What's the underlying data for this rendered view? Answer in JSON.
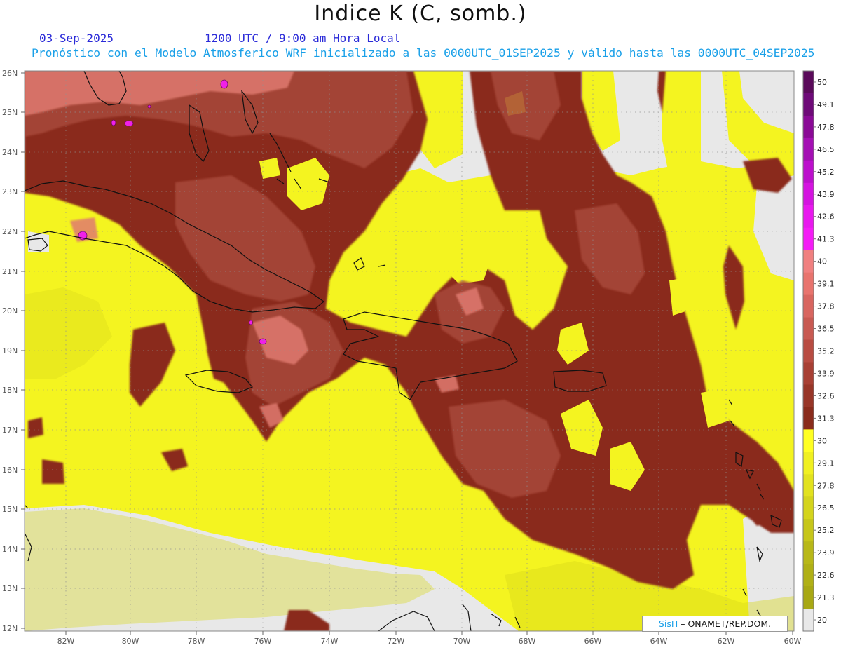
{
  "header": {
    "title": "Indice K (C, somb.)",
    "date": "03-Sep-2025",
    "time": "1200 UTC / 9:00 am Hora Local",
    "forecast": "Pronóstico con el Modelo Atmosferico WRF inicializado a las 0000UTC_01SEP2025 y válido hasta las  0000UTC_04SEP2025"
  },
  "axes": {
    "lat_labels": [
      "26N",
      "25N",
      "24N",
      "23N",
      "22N",
      "21N",
      "20N",
      "19N",
      "18N",
      "17N",
      "16N",
      "15N",
      "14N",
      "13N",
      "12N"
    ],
    "lon_labels": [
      "82W",
      "80W",
      "78W",
      "76W",
      "74W",
      "72W",
      "70W",
      "68W",
      "66W",
      "64W",
      "62W",
      "60W"
    ]
  },
  "colorbar": {
    "labels": [
      "50",
      "49.1",
      "47.8",
      "46.5",
      "45.2",
      "43.9",
      "42.6",
      "41.3",
      "40",
      "39.1",
      "37.8",
      "36.5",
      "35.2",
      "33.9",
      "32.6",
      "31.3",
      "30",
      "29.1",
      "27.8",
      "26.5",
      "25.2",
      "23.9",
      "22.6",
      "21.3",
      "20"
    ],
    "colors": [
      "#5a0a5a",
      "#6e0a78",
      "#8a0a96",
      "#a410b4",
      "#bc10cc",
      "#d414e0",
      "#e818ee",
      "#f41cf6",
      "#f08080",
      "#e8746e",
      "#d86660",
      "#c85a52",
      "#b84c42",
      "#a84034",
      "#983628",
      "#8a2c1c",
      "#ffff22",
      "#f0f020",
      "#e2e21e",
      "#d4d41c",
      "#c6c61a",
      "#b8b818",
      "#b0b016",
      "#a8a814",
      "#e8e8e8"
    ]
  },
  "legend": {
    "sis": "SisΠ",
    "rest": " ONAMET/REP.DOM."
  },
  "palette": {
    "background": "#e8e8e8",
    "yellow": "#f4f420",
    "yellow_dark": "#d8d81c",
    "brown_dark": "#8a2c1c",
    "brown_mid": "#a8483a",
    "brown_light": "#c86458",
    "salmon": "#e07a70",
    "magenta": "#f020e8"
  }
}
